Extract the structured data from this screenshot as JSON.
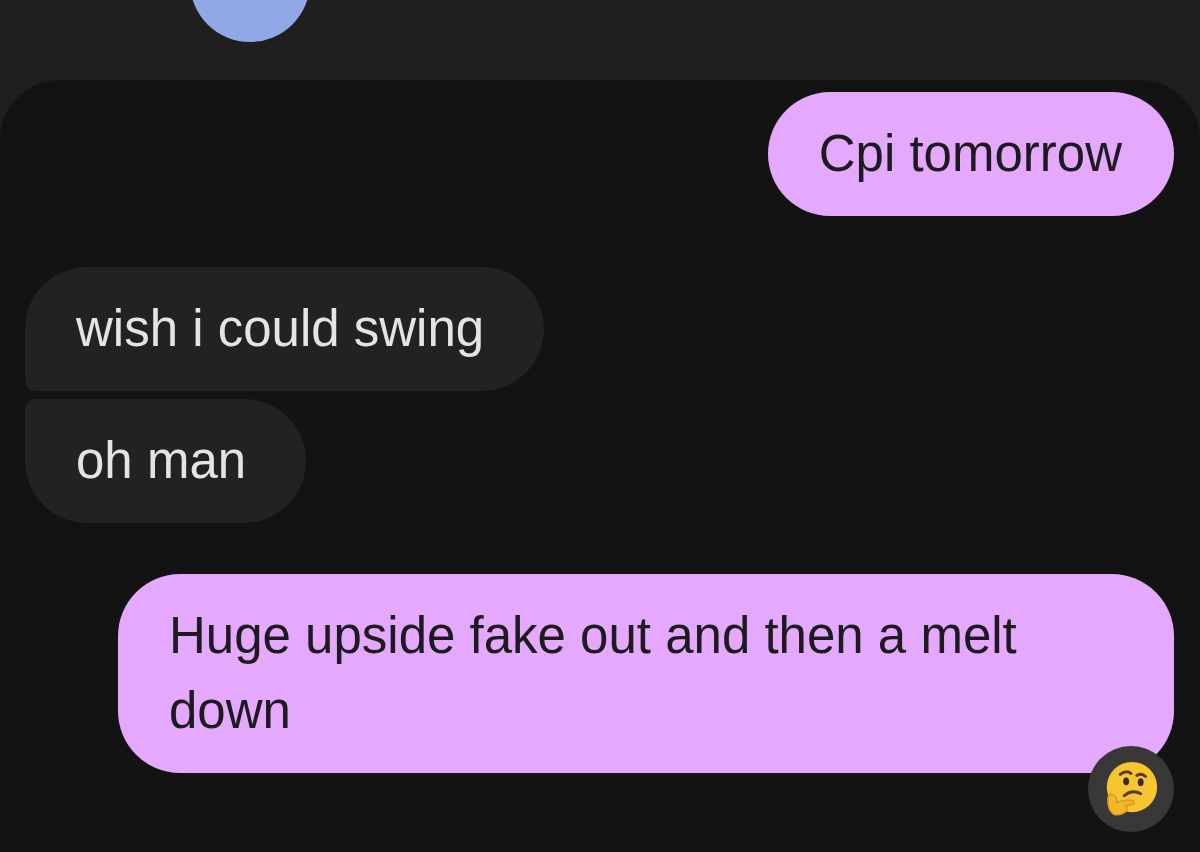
{
  "conversation": {
    "messages": [
      {
        "kind": "sent",
        "text": "Cpi tomorrow",
        "reacted": false
      },
      {
        "kind": "received",
        "text": "wish i could swing",
        "reacted": false
      },
      {
        "kind": "received",
        "text": "oh man",
        "reacted": false
      },
      {
        "kind": "sent",
        "text": "Huge upside fake out and then a melt down",
        "reacted": true
      }
    ]
  }
}
